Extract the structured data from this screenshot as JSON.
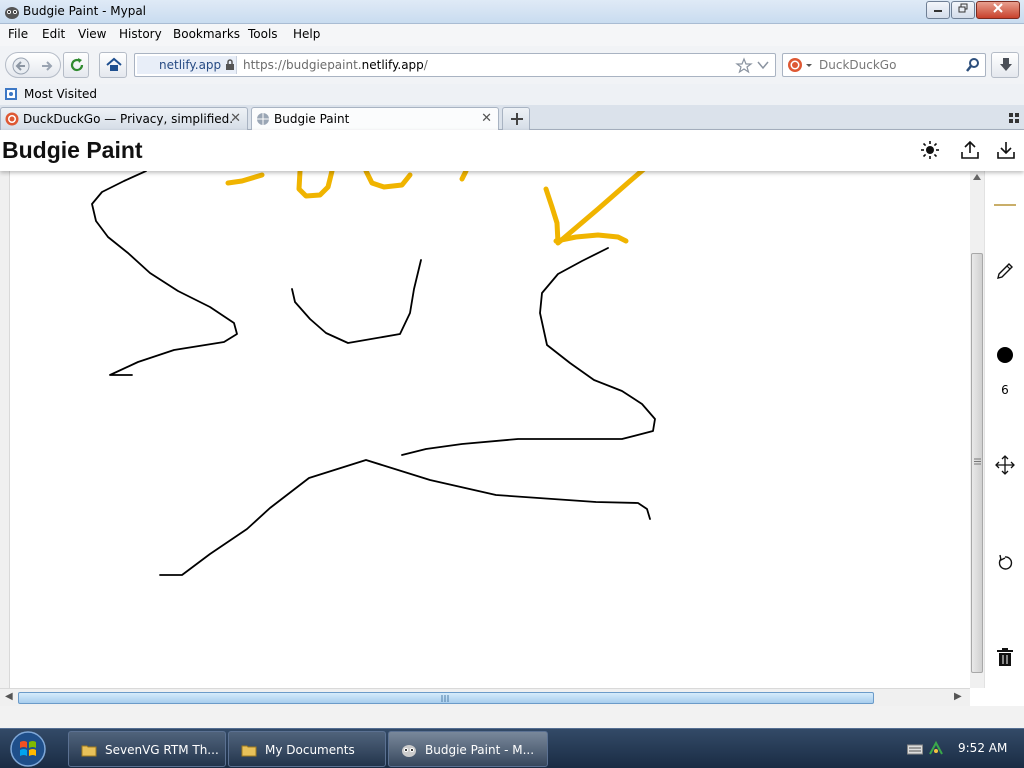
{
  "window": {
    "title": "Budgie Paint - Mypal"
  },
  "menu": [
    "File",
    "Edit",
    "View",
    "History",
    "Bookmarks",
    "Tools",
    "Help"
  ],
  "nav": {
    "identity": "netlify.app",
    "url_prefix": "https://budgiepaint.",
    "url_domain": "netlify.app",
    "url_suffix": "/",
    "search_placeholder": "DuckDuckGo"
  },
  "bookmarks": {
    "most_visited": "Most Visited"
  },
  "tabs": [
    {
      "label": "DuckDuckGo — Privacy, simplified.",
      "active": false
    },
    {
      "label": "Budgie Paint",
      "active": true
    }
  ],
  "app": {
    "title": "Budgie Paint",
    "brush_size": "6",
    "colors": {
      "stroke_black": "#000000",
      "stroke_yellow": "#f0b400"
    }
  },
  "taskbar": {
    "items": [
      {
        "label": "SevenVG RTM Th...",
        "active": false
      },
      {
        "label": "My Documents",
        "active": false
      },
      {
        "label": "Budgie Paint - M...",
        "active": true
      }
    ],
    "clock": "9:52 AM"
  }
}
